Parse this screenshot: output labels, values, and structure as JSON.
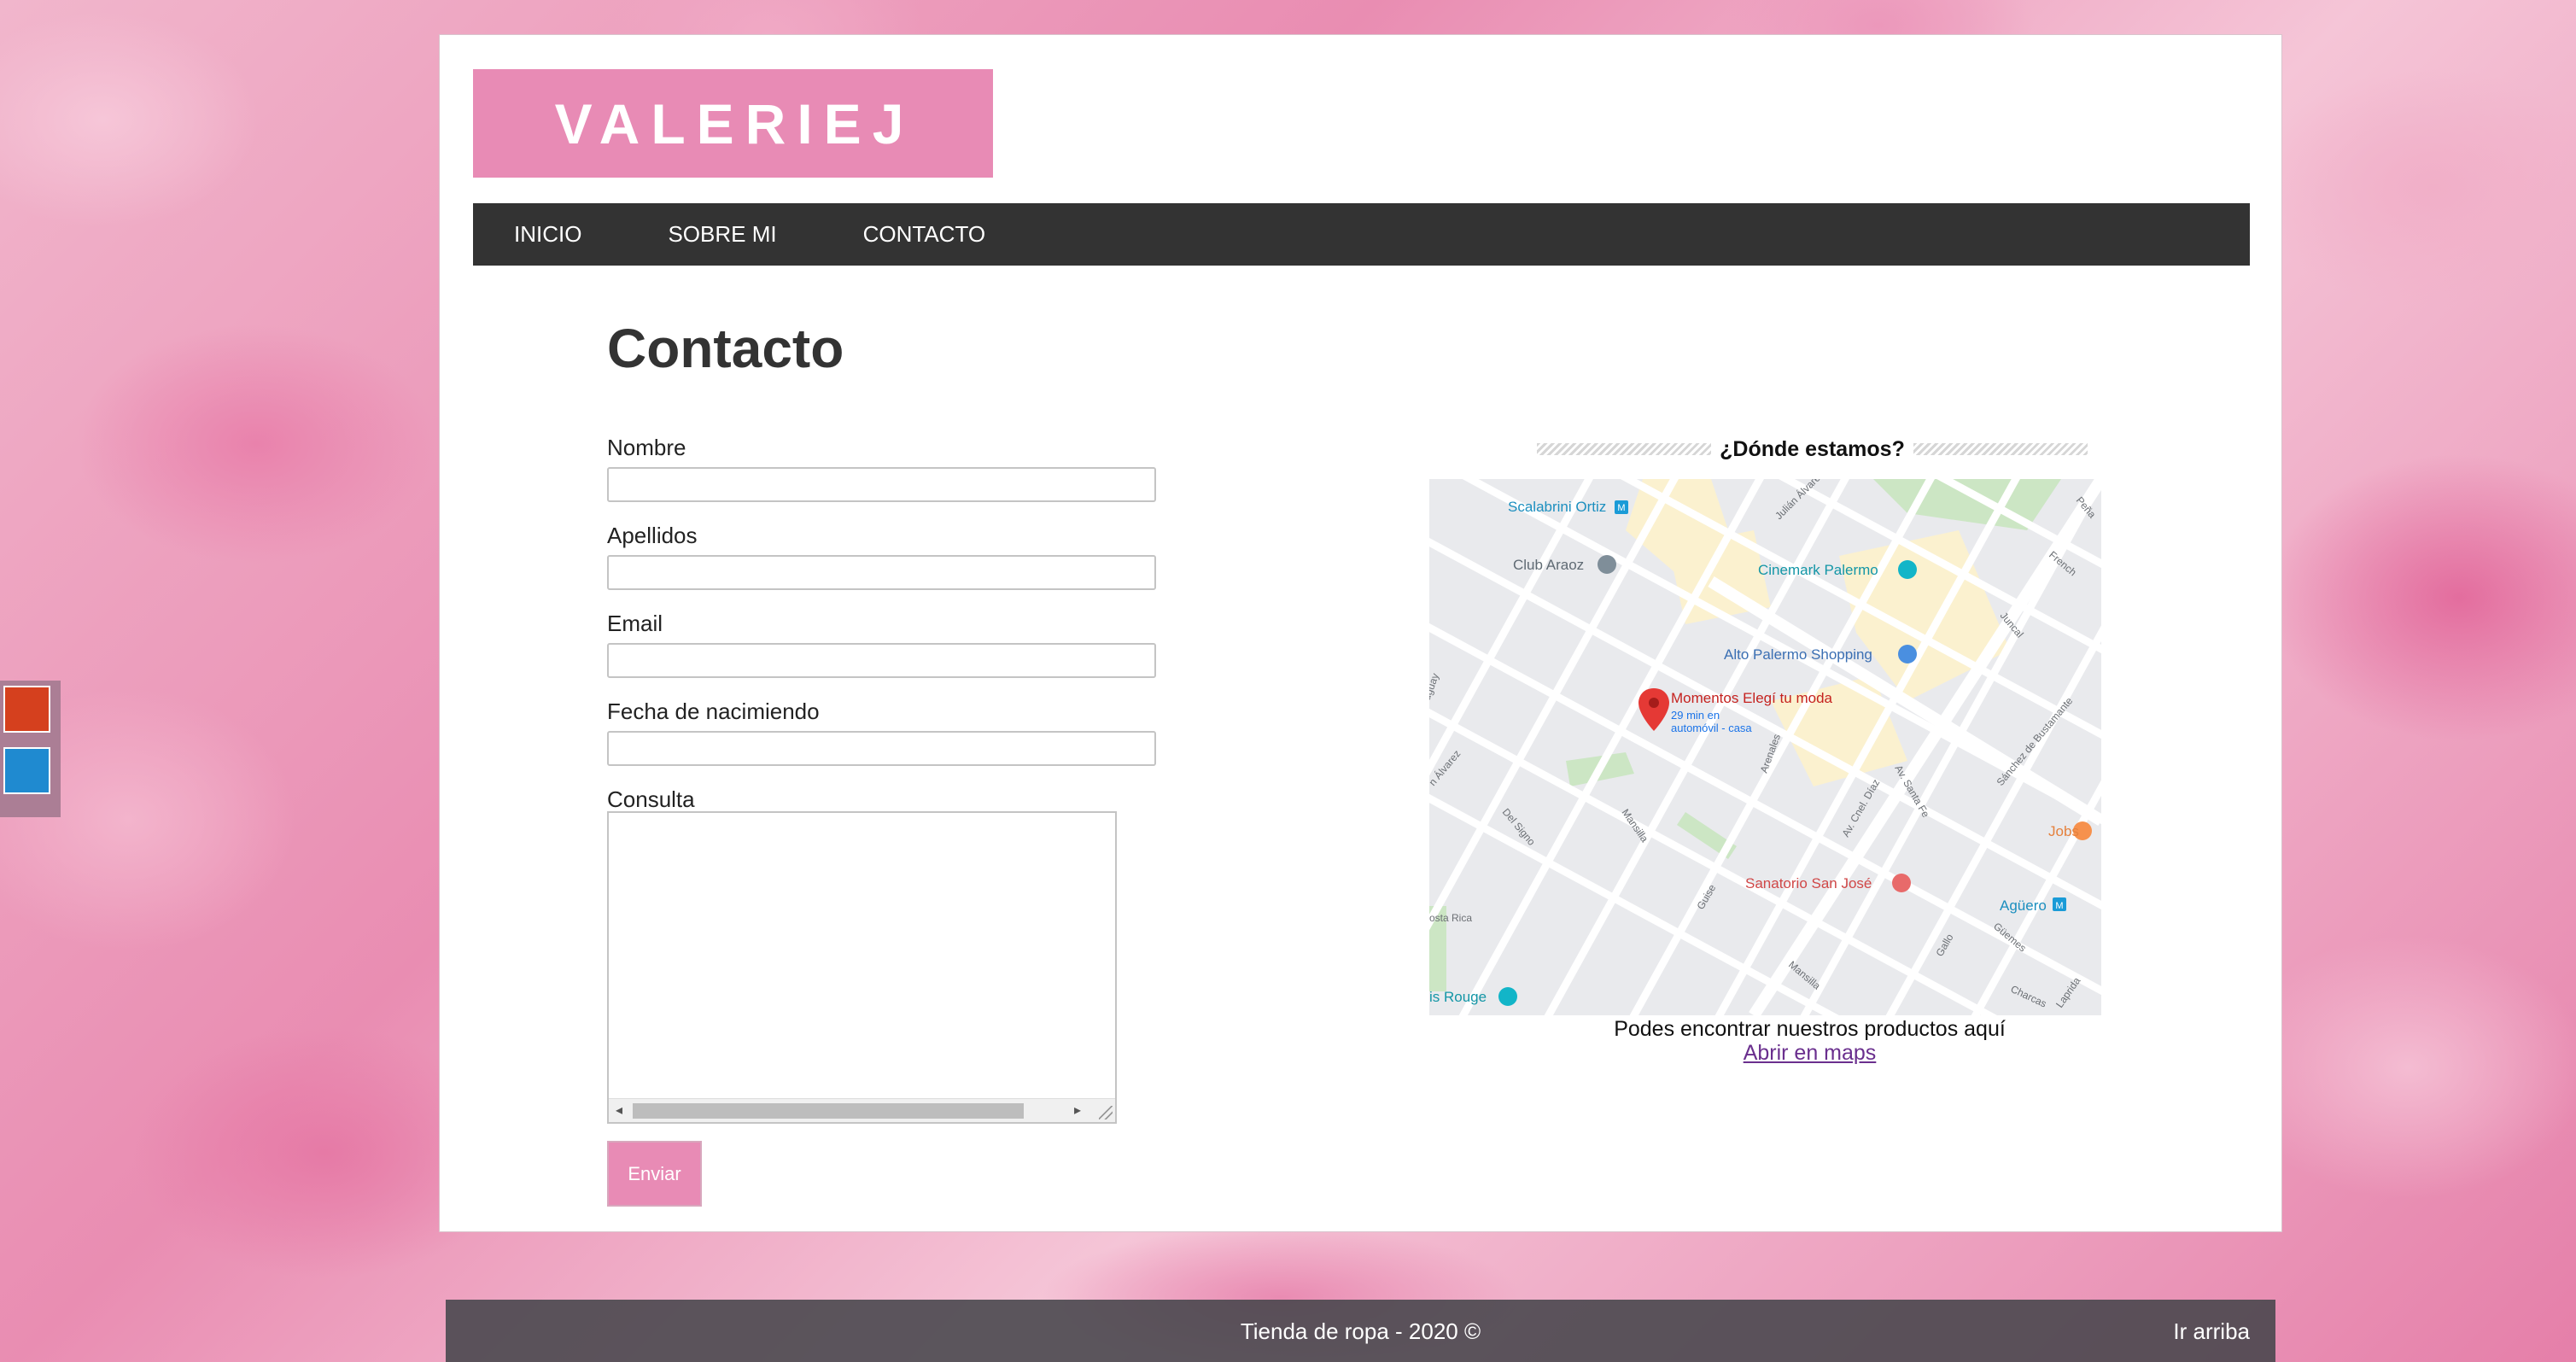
{
  "logo": {
    "text": "VALERIEJ"
  },
  "nav": {
    "items": [
      {
        "label": "INICIO"
      },
      {
        "label": "SOBRE MI"
      },
      {
        "label": "CONTACTO"
      }
    ]
  },
  "theme_swatches": {
    "colors": [
      "#d5401e",
      "#1f8ad0"
    ]
  },
  "form": {
    "title": "Contacto",
    "fields": [
      {
        "label": "Nombre",
        "value": ""
      },
      {
        "label": "Apellidos",
        "value": ""
      },
      {
        "label": "Email",
        "value": ""
      },
      {
        "label": "Fecha de nacimiendo",
        "value": ""
      }
    ],
    "message_label": "Consulta",
    "message_value": "",
    "submit_label": "Enviar"
  },
  "location": {
    "heading": "¿Dónde estamos?",
    "map": {
      "marker_title": "Momentos Elegí tu moda",
      "marker_line1": "29 min en",
      "marker_line2": "automóvil - casa",
      "places": {
        "scalabrini": "Scalabrini Ortiz",
        "club": "Club Araoz",
        "cinemark": "Cinemark Palermo",
        "alto": "Alto Palermo Shopping",
        "jobs": "Jobs",
        "sanatorio": "Sanatorio San José",
        "aguero": "Agüero",
        "rouge": "is Rouge"
      },
      "streets": {
        "santa_fe": "Av. Santa Fe",
        "coronel_diaz": "Av. Cnel. Díaz",
        "charcas": "Charcas",
        "mansilla": "Mansilla",
        "soler": "Del Signo",
        "french": "French",
        "juncal": "Juncal",
        "guemes": "Güemes",
        "arenales": "Arenales",
        "gallo": "Gallo",
        "lavalle": "Laprida",
        "sanchez": "Sánchez de Bustamante",
        "julian": "Julián Álvarez",
        "pena": "Peña",
        "costa": "osta Rica",
        "aralvarez": "n Álvarez",
        "uriarte": "uguay",
        "cerviño": "Guise",
        "pasaje": "Mansilla"
      }
    },
    "caption": "Podes encontrar nuestros productos aquí",
    "link_label": "Abrir en maps"
  },
  "footer": {
    "text": "Tienda de ropa - 2020 ©",
    "back_to_top": "Ir arriba"
  }
}
